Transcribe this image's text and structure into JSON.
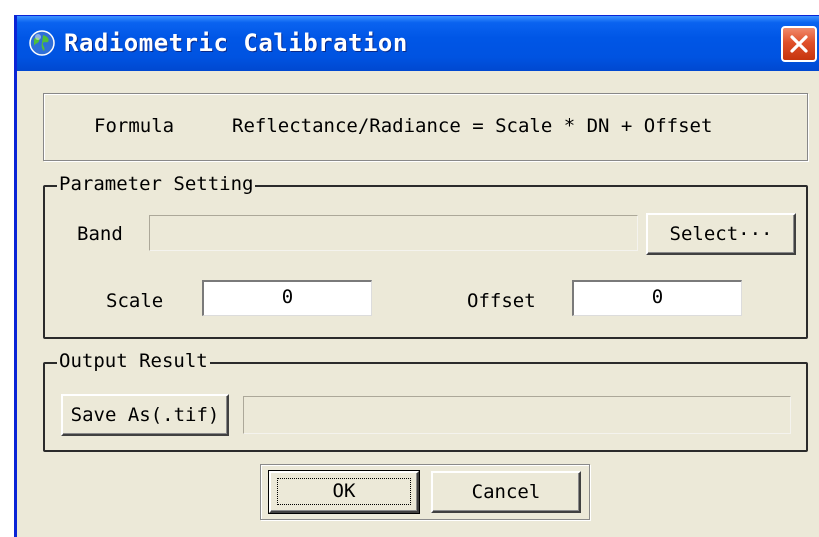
{
  "window": {
    "title": "Radiometric Calibration",
    "icon": "globe-icon",
    "close_icon": "close-icon",
    "titlebar_color": "#0054e3",
    "close_color": "#d6401c"
  },
  "formula": {
    "label": "Formula",
    "text": "Reflectance/Radiance = Scale * DN + Offset"
  },
  "parameter_setting": {
    "legend": "Parameter Setting",
    "band_label": "Band",
    "band_value": "",
    "select_button": "Select···",
    "scale_label": "Scale",
    "scale_value": "0",
    "offset_label": "Offset",
    "offset_value": "0"
  },
  "output_result": {
    "legend": "Output Result",
    "save_button": "Save As(.tif)",
    "path_value": ""
  },
  "buttons": {
    "ok": "OK",
    "cancel": "Cancel"
  }
}
